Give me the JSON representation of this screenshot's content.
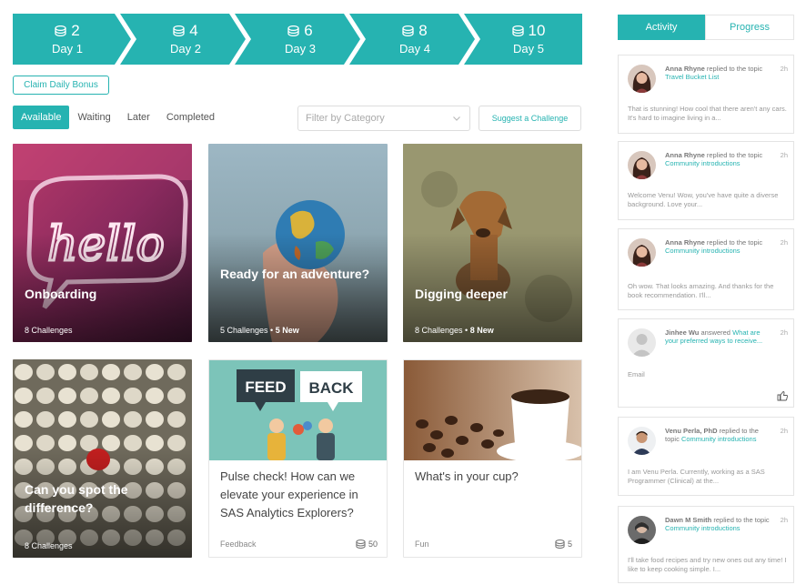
{
  "progress": {
    "steps": [
      {
        "points": "2",
        "day": "Day 1"
      },
      {
        "points": "4",
        "day": "Day 2"
      },
      {
        "points": "6",
        "day": "Day 3"
      },
      {
        "points": "8",
        "day": "Day 4"
      },
      {
        "points": "10",
        "day": "Day 5"
      }
    ],
    "bonus_label": "Claim Daily Bonus"
  },
  "filters": {
    "tabs": [
      "Available",
      "Waiting",
      "Later",
      "Completed"
    ],
    "category_placeholder": "Filter by Category",
    "suggest_label": "Suggest a Challenge"
  },
  "cards": [
    {
      "title": "Onboarding",
      "meta": "8 Challenges",
      "meta_new": ""
    },
    {
      "title": "Ready for an adventure?",
      "meta": "5 Challenges",
      "meta_new": "5 New"
    },
    {
      "title": "Digging deeper",
      "meta": "8 Challenges",
      "meta_new": "8 New"
    },
    {
      "title": "Can you spot the difference?",
      "meta": "8 Challenges",
      "meta_new": ""
    },
    {
      "title": "Pulse check! How can we elevate your experience in SAS Analytics Explorers?",
      "tag": "Feedback",
      "points": "50",
      "feedback_word1": "FEED",
      "feedback_word2": "BACK"
    },
    {
      "title": "What's in your cup?",
      "tag": "Fun",
      "points": "5"
    }
  ],
  "panel": {
    "tabs": [
      "Activity",
      "Progress"
    ],
    "items": [
      {
        "name": "Anna Rhyne",
        "action": " replied to the topic ",
        "topic": "Travel Bucket List",
        "time": "2h",
        "body": "That is stunning! How cool that there aren't any cars. It's hard to imagine living in a..."
      },
      {
        "name": "Anna Rhyne",
        "action": " replied to the topic ",
        "topic": "Community introductions",
        "time": "2h",
        "body": "Welcome Venu! Wow, you've have quite a diverse background. Love your..."
      },
      {
        "name": "Anna Rhyne",
        "action": " replied to the topic ",
        "topic": "Community introductions",
        "time": "2h",
        "body": "Oh wow. That looks amazing. And thanks for the book recommendation. I'll..."
      },
      {
        "name": "Jinhee Wu",
        "action": " answered ",
        "topic": "What are your preferred ways to receive...",
        "time": "2h",
        "body": "Email"
      },
      {
        "name": "Venu Perla, PhD",
        "action": " replied to the topic ",
        "topic": "Community introductions",
        "time": "2h",
        "body": "I am Venu Perla. Currently, working as a SAS Programmer (Clinical) at the..."
      },
      {
        "name": "Dawn M Smith",
        "action": " replied to the topic ",
        "topic": "Community introductions",
        "time": "2h",
        "body": "I'll take food recipes and try new ones out any time! I like to keep cooking simple. I..."
      }
    ]
  },
  "colors": {
    "accent": "#26b3b1"
  }
}
